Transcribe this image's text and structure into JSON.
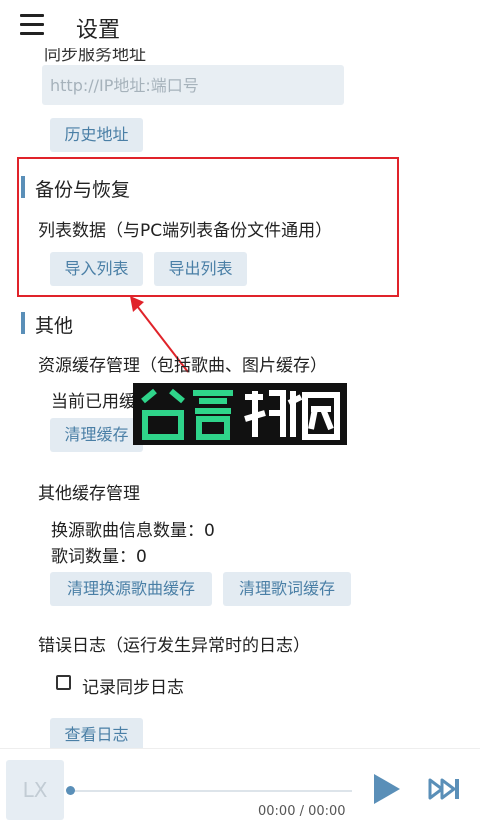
{
  "header": {
    "title": "设置",
    "menu_icon": "menu-icon"
  },
  "sync": {
    "server_label": "同步服务地址",
    "server_placeholder": "http://IP地址:端口号",
    "history_button": "历史地址"
  },
  "backup": {
    "section_title": "备份与恢复",
    "list_data_label": "列表数据（与PC端列表备份文件通用）",
    "import_button": "导入列表",
    "export_button": "导出列表"
  },
  "other": {
    "section_title": "其他",
    "resource_cache_label": "资源缓存管理（包括歌曲、图片缓存）",
    "current_cache_label": "当前已用缓存大小：",
    "clear_cache_button": "清理缓存",
    "other_cache_label": "其他缓存管理",
    "source_count_text": "换源歌曲信息数量：0",
    "lyric_count_text": "歌词数量：0",
    "clear_source_button": "清理换源歌曲缓存",
    "clear_lyric_button": "清理歌词缓存",
    "error_log_label": "错误日志（运行发生异常时的日志）",
    "record_sync_log_label": "记录同步日志",
    "record_sync_log_checked": false,
    "view_log_button": "查看日志"
  },
  "watermark": {
    "text": "谷普软件园"
  },
  "player": {
    "cover_text": "LX",
    "time_text": "00:00 / 00:00",
    "progress": 0,
    "play_icon": "play-icon",
    "next_icon": "next-icon"
  },
  "colors": {
    "accent": "#5a8fb8",
    "highlight": "#e0232a",
    "button_bg": "#e3ebf2",
    "button_text": "#4a7fa6"
  }
}
